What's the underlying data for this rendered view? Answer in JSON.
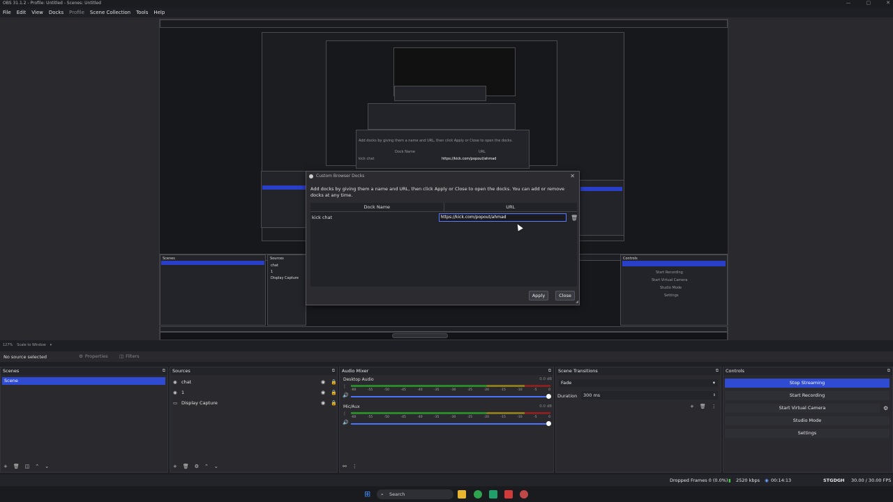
{
  "window": {
    "title": "OBS 31.1.2 - Profile: Untitled - Scenes: Untitled"
  },
  "menu": [
    "File",
    "Edit",
    "View",
    "Docks",
    "Profile",
    "Scene Collection",
    "Tools",
    "Help"
  ],
  "dialog": {
    "title": "Custom Browser Docks",
    "description": "Add docks by giving them a name and URL, then click Apply or Close to open the docks. You can add or remove docks at any time.",
    "col_name": "Dock Name",
    "col_url": "URL",
    "row_name": "kick chat",
    "row_url": "https://kick.com/popout/ahmad",
    "apply": "Apply",
    "close": "Close"
  },
  "preview": {
    "zoom": "127%",
    "scale_mode": "Scale to Window"
  },
  "properties_bar": {
    "no_source": "No source selected",
    "properties": "Properties",
    "filters": "Filters"
  },
  "scenes": {
    "title": "Scenes",
    "items": [
      "Scene"
    ]
  },
  "sources": {
    "title": "Sources",
    "items": [
      "chat",
      "1",
      "Display Capture"
    ]
  },
  "mixer": {
    "title": "Audio Mixer",
    "channels": [
      {
        "name": "Desktop Audio",
        "db": "0.0 dB"
      },
      {
        "name": "Mic/Aux",
        "db": "0.0 dB"
      }
    ],
    "ticks": [
      "-60",
      "-55",
      "-50",
      "-45",
      "-40",
      "-35",
      "-30",
      "-25",
      "-20",
      "-15",
      "-10",
      "-5",
      "0"
    ]
  },
  "transitions": {
    "title": "Scene Transitions",
    "type": "Fade",
    "duration_label": "Duration",
    "duration_value": "300 ms"
  },
  "controls": {
    "title": "Controls",
    "buttons": [
      "Stop Streaming",
      "Start Recording",
      "Start Virtual Camera",
      "Studio Mode",
      "Settings"
    ]
  },
  "status": {
    "dropped": "Dropped Frames 0 (0.0%)",
    "kbps": "2520 kbps",
    "time": "00:14:13",
    "user": "STGDGH",
    "fps": "30.00 / 30.00 FPS"
  },
  "taskbar": {
    "search": "Search"
  },
  "colors": {
    "accent": "#2f4bd1",
    "bg": "#2a2a2e"
  }
}
